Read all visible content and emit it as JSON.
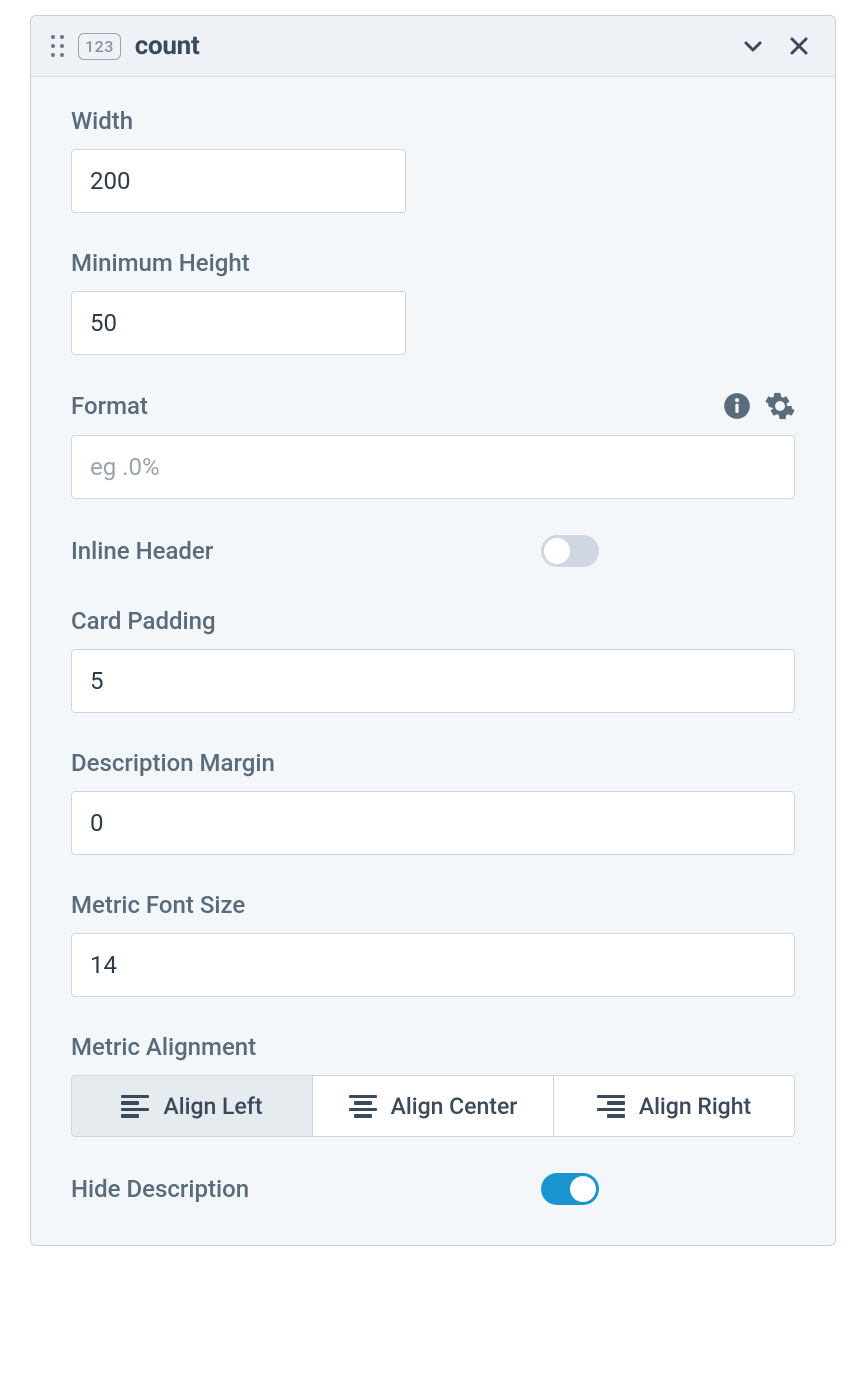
{
  "header": {
    "type_badge": "123",
    "title": "count"
  },
  "fields": {
    "width": {
      "label": "Width",
      "value": "200"
    },
    "min_height": {
      "label": "Minimum Height",
      "value": "50"
    },
    "format": {
      "label": "Format",
      "placeholder": "eg .0%",
      "value": ""
    },
    "inline_header": {
      "label": "Inline Header",
      "on": false
    },
    "card_padding": {
      "label": "Card Padding",
      "value": "5"
    },
    "description_margin": {
      "label": "Description Margin",
      "value": "0"
    },
    "metric_font_size": {
      "label": "Metric Font Size",
      "value": "14"
    },
    "metric_alignment": {
      "label": "Metric Alignment",
      "options": [
        "Align Left",
        "Align Center",
        "Align Right"
      ],
      "selected": 0
    },
    "hide_description": {
      "label": "Hide Description",
      "on": true
    }
  }
}
